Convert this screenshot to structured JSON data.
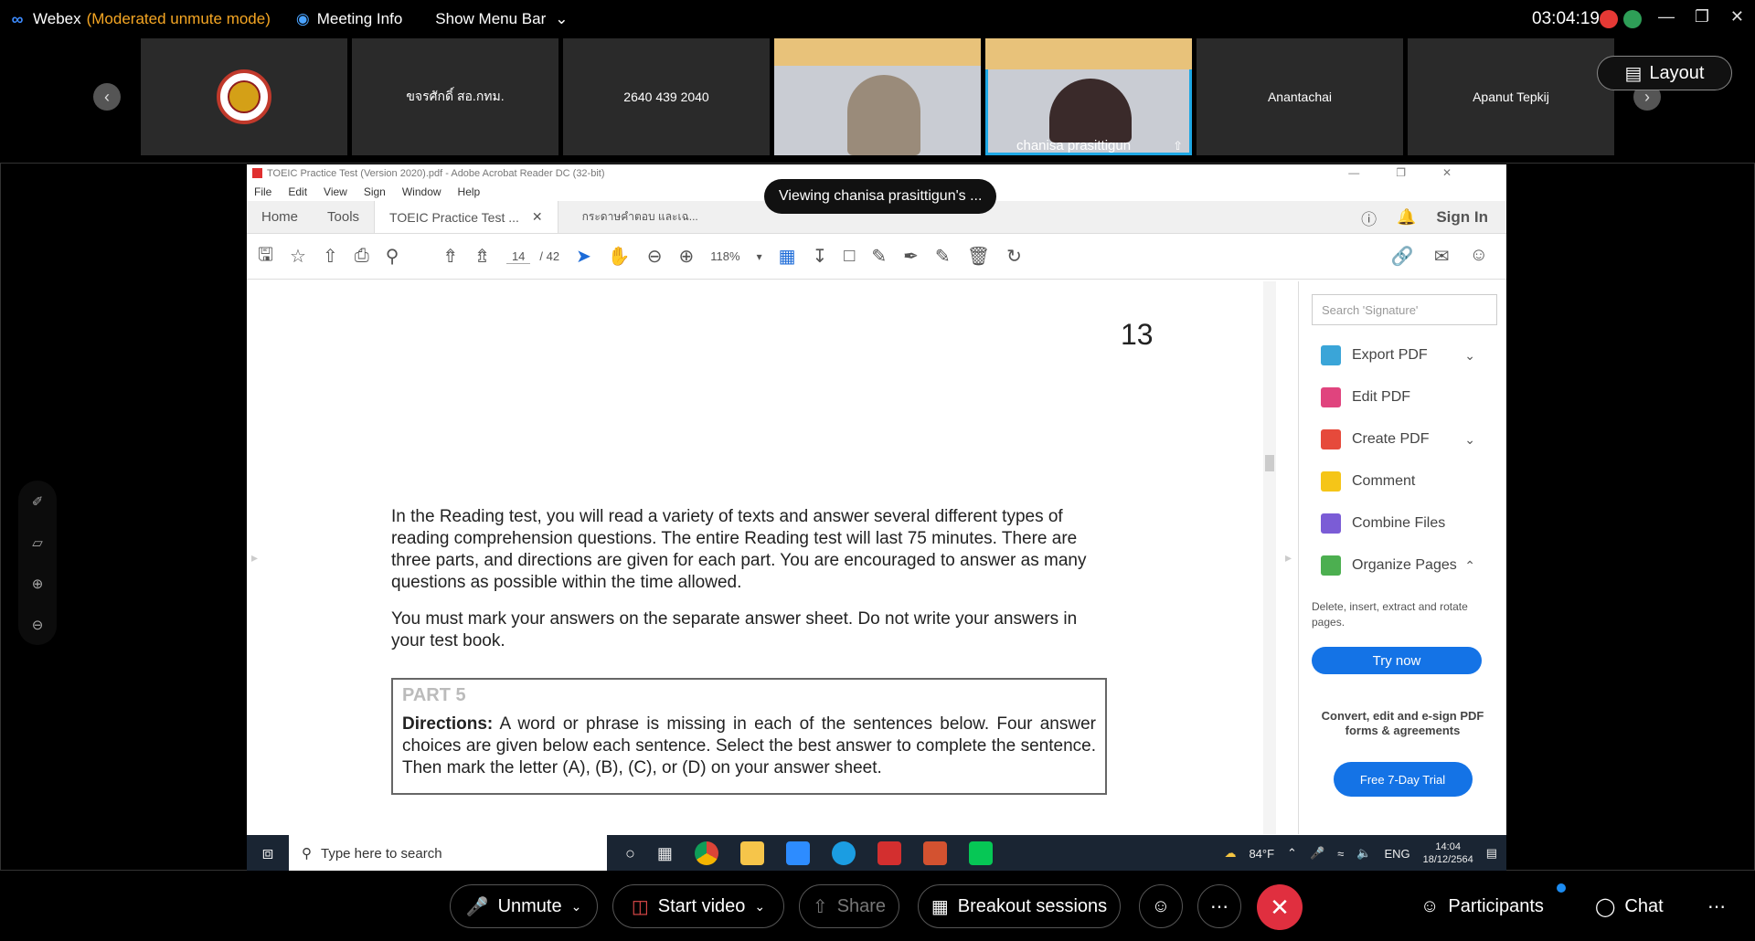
{
  "topbar": {
    "app_name": "Webex",
    "mode": "(Moderated unmute mode)",
    "meeting_info": "Meeting Info",
    "show_menu": "Show Menu Bar",
    "clock": "03:04:19"
  },
  "participants": [
    {
      "label": ""
    },
    {
      "label": "ขจรศักดิ์ สอ.กทม."
    },
    {
      "label": "2640 439 2040"
    },
    {
      "label": ""
    },
    {
      "label": "chanisa prasittigun"
    },
    {
      "label": "Anantachai"
    },
    {
      "label": "Apanut Tepkij"
    }
  ],
  "layout_button": "Layout",
  "viewing_banner": "Viewing chanisa prasittigun's ...",
  "acrobat": {
    "title": "TOEIC Practice Test (Version 2020).pdf - Adobe Acrobat Reader DC (32-bit)",
    "menu": [
      "File",
      "Edit",
      "View",
      "Sign",
      "Window",
      "Help"
    ],
    "tabs": {
      "home": "Home",
      "tools": "Tools",
      "doc1": "TOEIC Practice Test ...",
      "doc2": "กระดาษคำตอบ และเฉ..."
    },
    "sign_in": "Sign In",
    "page_current": "14",
    "page_total": "/ 42",
    "zoom": "118%",
    "page_number": "13",
    "reading_p1": "In the Reading test, you will read a variety of texts and answer several different types of reading comprehension questions. The entire Reading test will last 75 minutes. There are three parts, and directions are given for each part. You are encouraged to answer as many questions as possible within the time allowed.",
    "reading_p2": "You must mark your answers on the separate answer sheet. Do not write your answers in your test book.",
    "part_title": "PART 5",
    "directions_label": "Directions:",
    "directions_text": "A word or phrase is missing in each of the sentences below. Four answer choices are given below each sentence. Select the best answer to complete the sentence. Then mark the letter (A), (B), (C), or (D) on your answer sheet.",
    "right_pane": {
      "search_placeholder": "Search 'Signature'",
      "items": [
        "Export PDF",
        "Edit PDF",
        "Create PDF",
        "Comment",
        "Combine Files",
        "Organize Pages"
      ],
      "desc": "Delete, insert, extract and rotate pages.",
      "try_now": "Try now",
      "promo": "Convert, edit and e-sign PDF forms & agreements",
      "trial": "Free 7-Day Trial"
    },
    "taskbar": {
      "search": "Type here to search",
      "weather": "84°F",
      "lang": "ENG",
      "time": "14:04",
      "date": "18/12/2564"
    }
  },
  "controls": {
    "unmute": "Unmute",
    "start_video": "Start video",
    "share": "Share",
    "breakout": "Breakout sessions",
    "participants": "Participants",
    "chat": "Chat"
  },
  "colors": {
    "accent": "#1ea8e5",
    "end": "#e02f3f",
    "adobe_blue": "#1473e6",
    "mode": "#f5a623"
  }
}
